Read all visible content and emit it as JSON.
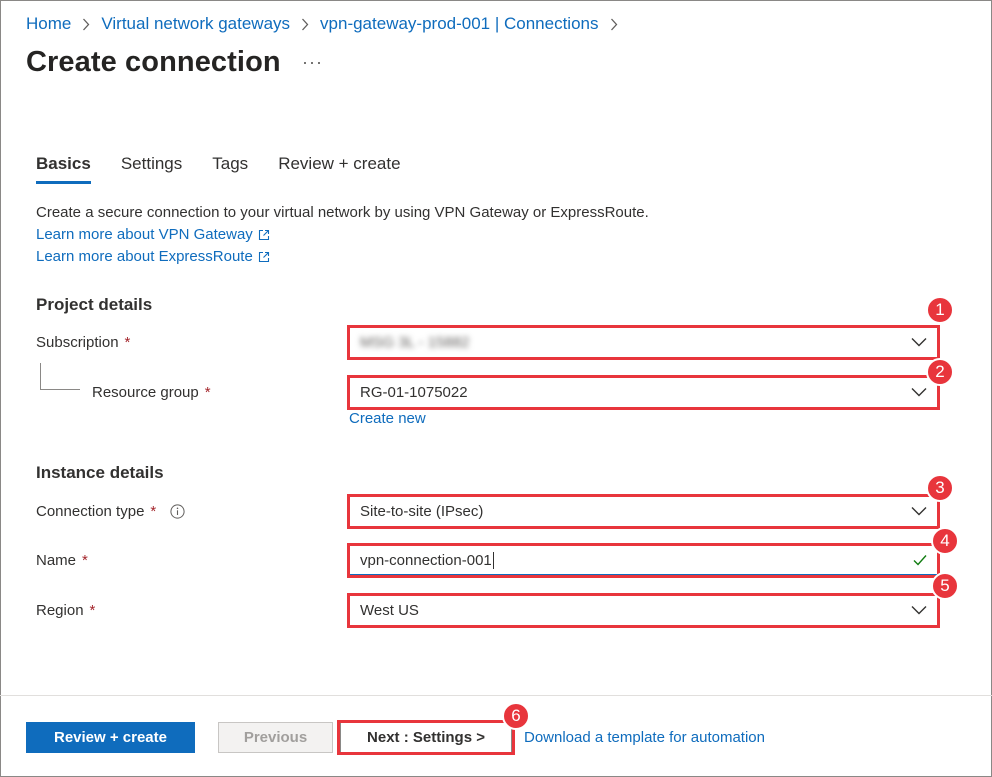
{
  "breadcrumb": {
    "items": [
      "Home",
      "Virtual network gateways",
      "vpn-gateway-prod-001 | Connections"
    ]
  },
  "page": {
    "title": "Create connection",
    "more_label": "···"
  },
  "tabs": [
    {
      "label": "Basics",
      "active": true
    },
    {
      "label": "Settings",
      "active": false
    },
    {
      "label": "Tags",
      "active": false
    },
    {
      "label": "Review + create",
      "active": false
    }
  ],
  "intro": {
    "text": "Create a secure connection to your virtual network by using VPN Gateway or ExpressRoute.",
    "link_vpn": "Learn more about VPN Gateway",
    "link_expressroute": "Learn more about ExpressRoute"
  },
  "project_details": {
    "heading": "Project details",
    "subscription_label": "Subscription",
    "subscription_value": "MSG 3L - 15882",
    "resource_group_label": "Resource group",
    "resource_group_value": "RG-01-1075022",
    "create_new": "Create new"
  },
  "instance_details": {
    "heading": "Instance details",
    "connection_type_label": "Connection type",
    "connection_type_value": "Site-to-site (IPsec)",
    "name_label": "Name",
    "name_value": "vpn-connection-001",
    "region_label": "Region",
    "region_value": "West US"
  },
  "required_marker": "*",
  "annotations": [
    "1",
    "2",
    "3",
    "4",
    "5",
    "6"
  ],
  "footer": {
    "review_create": "Review + create",
    "previous": "Previous",
    "next": "Next : Settings >",
    "download": "Download a template for automation"
  },
  "colors": {
    "accent": "#0f6cbd",
    "required": "#a4262c",
    "highlight": "#e8353c",
    "valid": "#107c10"
  },
  "icons": {
    "breadcrumb_separator": "chevron-right-icon",
    "dropdown": "chevron-down-icon",
    "external_link": "external-link-icon",
    "info": "info-icon",
    "valid": "checkmark-icon"
  }
}
